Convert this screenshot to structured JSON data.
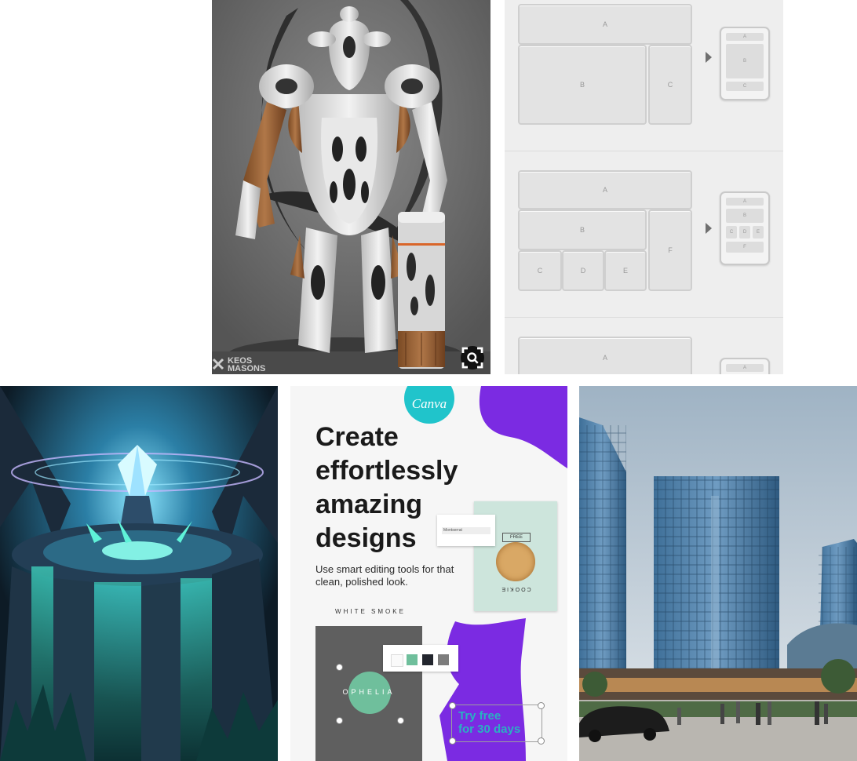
{
  "feed": {
    "pins": [
      {
        "kind": "3d-character-render",
        "watermark_lines": [
          "KEOS",
          "MASONS"
        ],
        "visual_search": "visual-search-icon"
      },
      {
        "kind": "responsive-layout-diagram",
        "groups": [
          {
            "desktop": [
              "A",
              "B",
              "C"
            ],
            "mobile": [
              "A",
              "B",
              "C"
            ]
          },
          {
            "desktop": [
              "A",
              "B",
              "C",
              "D",
              "E",
              "F"
            ],
            "mobile": [
              "A",
              "B",
              "C",
              "D",
              "E",
              "F"
            ]
          },
          {
            "desktop": [
              "A"
            ],
            "mobile": [
              "A"
            ]
          }
        ]
      },
      {
        "kind": "fantasy-crystal-artwork"
      },
      {
        "kind": "canva-ad",
        "logo": "Canva",
        "headline_lines": [
          "Create",
          "effortlessly",
          "amazing",
          "designs"
        ],
        "subline": "Use smart editing tools for that clean, polished look.",
        "font_menu": [
          "Montserrat"
        ],
        "white_smoke": "WHITE SMOKE",
        "poster_title": "OPHELIA",
        "cookie_card": {
          "free": "FREE",
          "cookie": "COOKIE"
        },
        "cta_lines": [
          "Try free",
          "for 30 days"
        ],
        "colors": {
          "accent_purple": "#7b2be2",
          "teal": "#20c4cb",
          "mint": "#6fbf9c"
        }
      },
      {
        "kind": "architecture-render"
      }
    ]
  }
}
